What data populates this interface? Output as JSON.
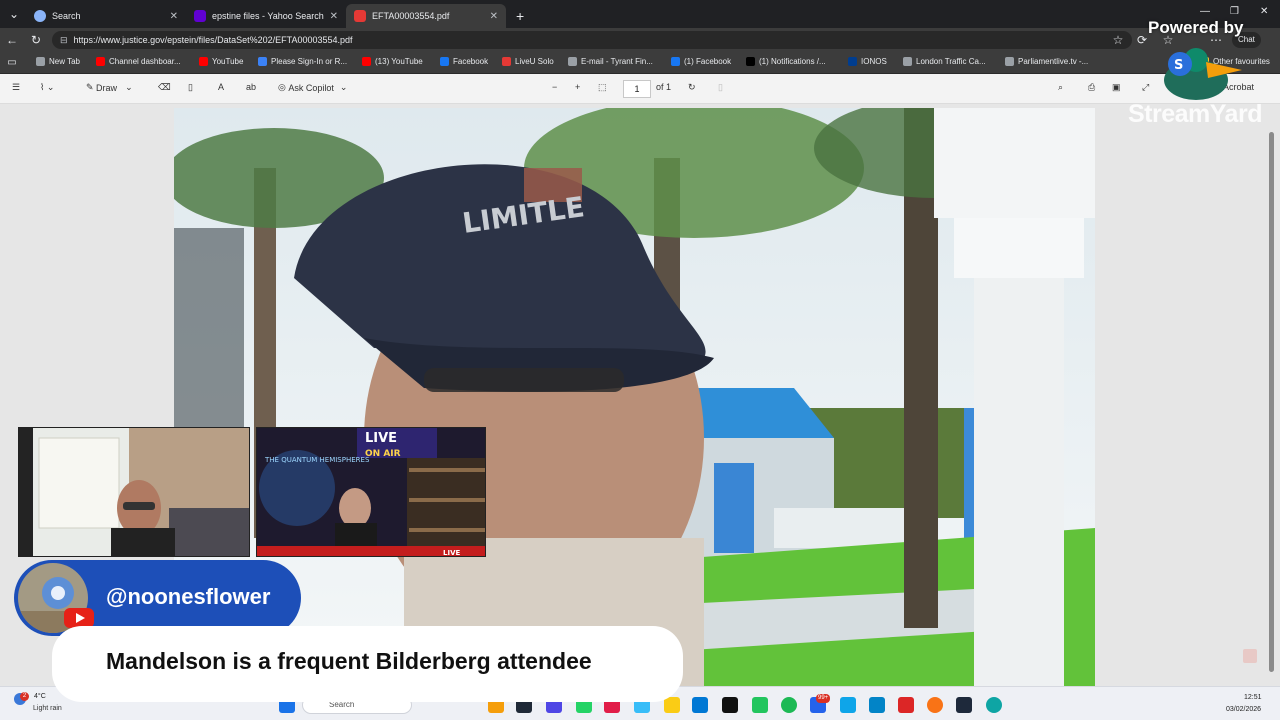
{
  "browser": {
    "tabs": [
      {
        "label": "Search",
        "icon": "globe-icon",
        "active": false
      },
      {
        "label": "epstine files - Yahoo Search Results",
        "icon": "yahoo-icon",
        "active": false
      },
      {
        "label": "EFTA00003554.pdf",
        "icon": "pdf-icon",
        "active": true
      }
    ],
    "new_tab_label": "+",
    "url": "https://www.justice.gov/epstein/files/DataSet%202/EFTA00003554.pdf",
    "chat_label": "Chat"
  },
  "bookmarks": {
    "items": [
      {
        "label": "New Tab",
        "color": "#9aa0a6"
      },
      {
        "label": "Channel dashboar...",
        "color": "#ff0000"
      },
      {
        "label": "YouTube",
        "color": "#ff0000"
      },
      {
        "label": "Please Sign-In or R...",
        "color": "#3b82f6"
      },
      {
        "label": "(13) YouTube",
        "color": "#ff0000"
      },
      {
        "label": "Facebook",
        "color": "#1877f2"
      },
      {
        "label": "LiveU Solo",
        "color": "#e53935"
      },
      {
        "label": "E-mail - Tyrant Fin...",
        "color": "#9aa0a6"
      },
      {
        "label": "(1) Facebook",
        "color": "#1877f2"
      },
      {
        "label": "(1) Notifications /...",
        "color": "#000000"
      },
      {
        "label": "IONOS",
        "color": "#003d8f"
      },
      {
        "label": "London Traffic Ca...",
        "color": "#9aa0a6"
      },
      {
        "label": "Parliamentlive.tv -...",
        "color": "#9aa0a6"
      }
    ],
    "other": "Other favourites"
  },
  "pdf_toolbar": {
    "draw": "Draw",
    "ask_copilot": "Ask Copilot",
    "page_current": "1",
    "page_total": "of 1",
    "edit_acrobat": "Edit in Acrobat"
  },
  "overlay": {
    "powered_by": "Powered by",
    "streamyard": "StreamYard",
    "handle": "@noonesflower",
    "banner": "Mandelson is a frequent Bilderberg attendee",
    "stream_live": "LIVE",
    "stream_on_air": "ON AIR",
    "stream_show": "THE QUANTUM HEMISPHERES"
  },
  "taskbar": {
    "weather_temp": "4°C",
    "weather_desc": "Light rain",
    "weather_badge": "2",
    "search": "Search",
    "badge_count": "99+",
    "time": "12:51",
    "date": "03/02/2026"
  }
}
